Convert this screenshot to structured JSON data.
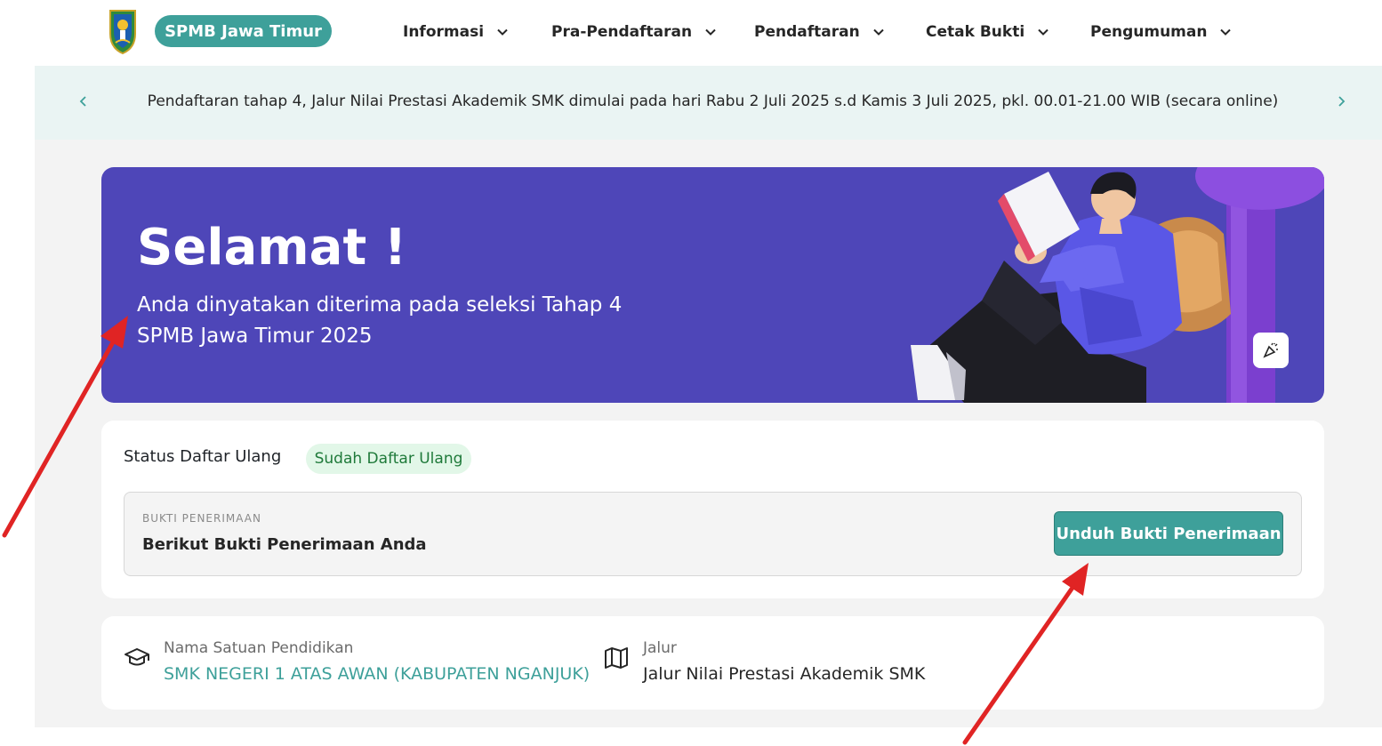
{
  "brand": {
    "name": "SPMB Jawa Timur"
  },
  "nav": [
    {
      "label": "Informasi"
    },
    {
      "label": "Pra-Pendaftaran"
    },
    {
      "label": "Pendaftaran"
    },
    {
      "label": "Cetak Bukti"
    },
    {
      "label": "Pengumuman"
    }
  ],
  "announcement": {
    "text": "Pendaftaran tahap 4, Jalur Nilai Prestasi Akademik SMK dimulai pada hari Rabu 2 Juli 2025 s.d Kamis 3 Juli 2025, pkl. 00.01-21.00 WIB (secara online)",
    "prev_icon": "chevron-left-icon",
    "next_icon": "chevron-right-icon"
  },
  "hero": {
    "title": "Selamat !",
    "subtitle_line1": "Anda dinyatakan diterima pada seleksi Tahap 4",
    "subtitle_line2": "SPMB Jawa Timur 2025",
    "action_icon": "confetti-icon"
  },
  "status": {
    "label": "Status Daftar Ulang",
    "badge": "Sudah Daftar Ulang",
    "badge_bg": "#e2f7e8",
    "badge_color": "#1f7a3a"
  },
  "proof": {
    "caption": "BUKTI PENERIMAAN",
    "title": "Berikut Bukti Penerimaan Anda",
    "download_label": "Unduh Bukti Penerimaan"
  },
  "school": {
    "label": "Nama Satuan Pendidikan",
    "value": "SMK NEGERI 1 ATAS AWAN (KABUPATEN NGANJUK)",
    "icon": "graduation-cap-icon"
  },
  "track": {
    "label": "Jalur",
    "value": "Jalur Nilai Prestasi Akademik SMK",
    "icon": "map-icon"
  },
  "colors": {
    "accent": "#3ea09a",
    "hero": "#4e46b8",
    "annotation": "#e02424"
  }
}
